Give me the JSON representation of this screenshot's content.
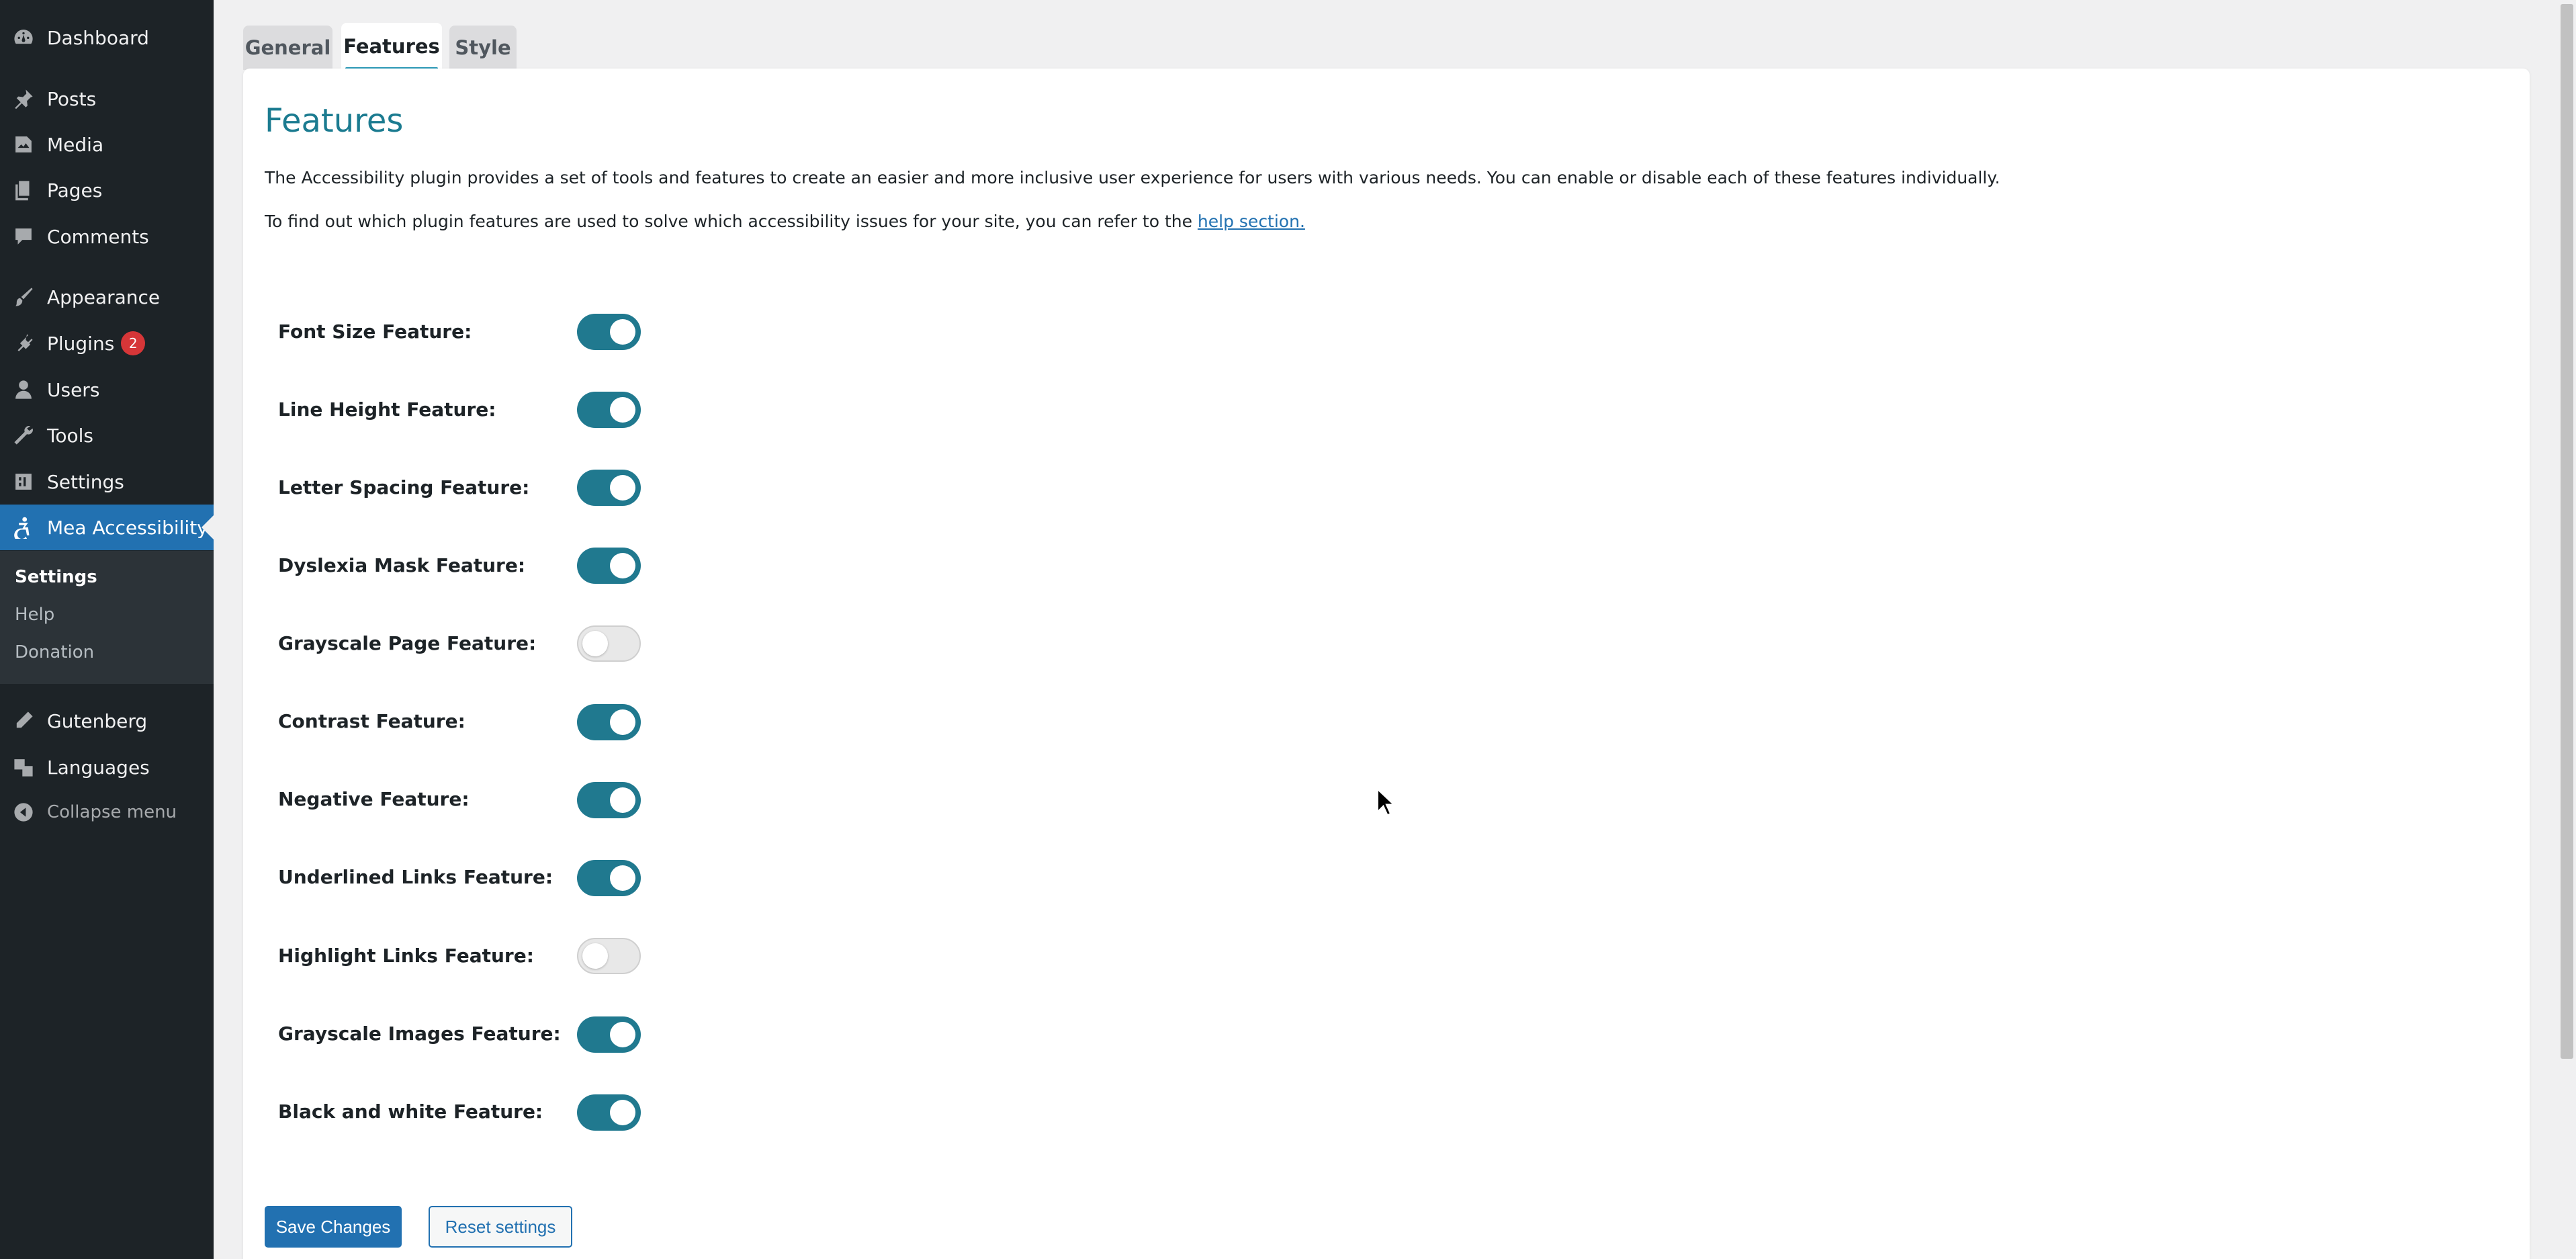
{
  "sidebar": {
    "items": [
      {
        "label": "Dashboard",
        "icon": "dashboard-icon"
      },
      {
        "label": "Posts",
        "icon": "pushpin-icon"
      },
      {
        "label": "Media",
        "icon": "media-icon"
      },
      {
        "label": "Pages",
        "icon": "pages-icon"
      },
      {
        "label": "Comments",
        "icon": "comment-icon"
      },
      {
        "label": "Appearance",
        "icon": "paintbrush-icon"
      },
      {
        "label": "Plugins",
        "icon": "plugin-icon",
        "badge": "2"
      },
      {
        "label": "Users",
        "icon": "user-icon"
      },
      {
        "label": "Tools",
        "icon": "wrench-icon"
      },
      {
        "label": "Settings",
        "icon": "settings-icon"
      },
      {
        "label": "Mea Accessibility",
        "icon": "accessibility-icon"
      },
      {
        "label": "Gutenberg",
        "icon": "pencil-icon"
      },
      {
        "label": "Languages",
        "icon": "translate-icon"
      },
      {
        "label": "Collapse menu",
        "icon": "collapse-icon"
      }
    ],
    "submenu": [
      "Settings",
      "Help",
      "Donation"
    ]
  },
  "tabs": [
    "General",
    "Features",
    "Style"
  ],
  "page": {
    "title": "Features",
    "desc1": "The Accessibility plugin provides a set of tools and features to create an easier and more inclusive user experience for users with various needs. You can enable or disable each of these features individually.",
    "desc2_prefix": "To find out which plugin features are used to solve which accessibility issues for your site, you can refer to the ",
    "desc2_link": "help section."
  },
  "features": [
    {
      "label": "Font Size Feature:",
      "enabled": true
    },
    {
      "label": "Line Height Feature:",
      "enabled": true
    },
    {
      "label": "Letter Spacing Feature:",
      "enabled": true
    },
    {
      "label": "Dyslexia Mask Feature:",
      "enabled": true
    },
    {
      "label": "Grayscale Page Feature:",
      "enabled": false
    },
    {
      "label": "Contrast Feature:",
      "enabled": true
    },
    {
      "label": "Negative Feature:",
      "enabled": true
    },
    {
      "label": "Underlined Links Feature:",
      "enabled": true
    },
    {
      "label": "Highlight Links Feature:",
      "enabled": false
    },
    {
      "label": "Grayscale Images Feature:",
      "enabled": true
    },
    {
      "label": "Black and white Feature:",
      "enabled": true
    }
  ],
  "buttons": {
    "save": "Save Changes",
    "reset": "Reset settings"
  },
  "colors": {
    "admin_bar": "#1d2327",
    "accent": "#2271b1",
    "toggle_on": "#20798f",
    "title": "#1b7b90"
  }
}
